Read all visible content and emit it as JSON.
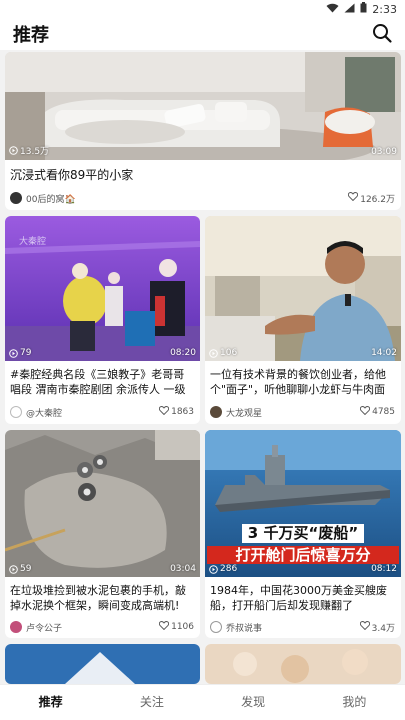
{
  "status": {
    "time": "2:33"
  },
  "header": {
    "title": "推荐"
  },
  "feed": [
    {
      "views": "13.5万",
      "duration": "03:09",
      "title": "沉浸式看你89平的小家",
      "author": "00后的窝🏠",
      "likes": "126.2万"
    },
    {
      "views": "79",
      "duration": "08:20",
      "title": "#秦腔经典名段《三娘教子》老哥哥唱段 渭南市秦腔剧团 余派传人 一级演员 冯爱...",
      "author": "@大秦腔",
      "likes": "1863"
    },
    {
      "views": "106",
      "duration": "14:02",
      "title": "一位有技术背景的餐饮创业者，给他个\"面子\"，听他聊聊小龙虾与牛肉面的故事。",
      "author": "大龙观星",
      "likes": "4785"
    },
    {
      "views": "59",
      "duration": "03:04",
      "title": "在垃圾堆捡到被水泥包裹的手机，敲掉水泥换个框架，瞬间变成高端机!",
      "author": "卢令公子",
      "likes": "1106"
    },
    {
      "views": "286",
      "duration": "08:12",
      "title": "1984年，中国花3000万美金买艘废船，打开船门后却发现赚翻了",
      "author": "乔叔说事",
      "likes": "3.4万",
      "overlay_line1": "3 千万买“废船”",
      "overlay_line2": "打开舱门后惊喜万分"
    }
  ],
  "tabs": [
    {
      "label": "推荐"
    },
    {
      "label": "关注"
    },
    {
      "label": "发现"
    },
    {
      "label": "我的"
    }
  ]
}
